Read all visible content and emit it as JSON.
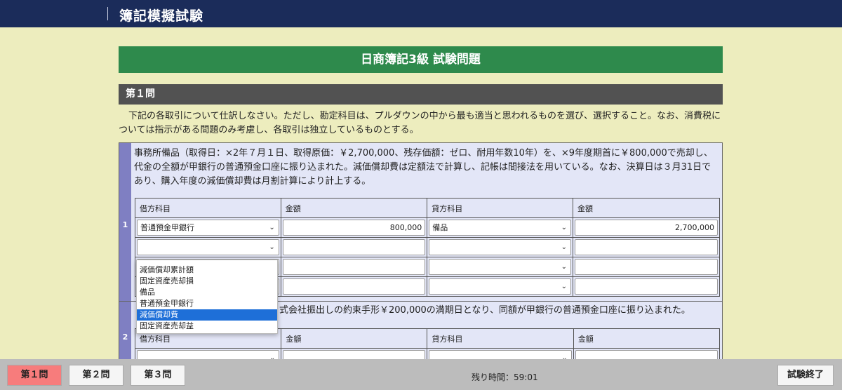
{
  "app": {
    "title": "簿記模擬試験"
  },
  "exam": {
    "title": "日商簿記3級 試験問題"
  },
  "section": {
    "title": "第１問"
  },
  "instructions": "下記の各取引について仕訳しなさい。ただし、勘定科目は、プルダウンの中から最も適当と思われるものを選び、選択すること。なお、消費税については指示がある問題のみ考慮し、各取引は独立しているものとする。",
  "questions": [
    {
      "number": "1",
      "text": "事務所備品（取得日：×2年７月１日、取得原価：￥2,700,000、残存価額：ゼロ、耐用年数10年）を、×9年度期首に￥800,000で売却し、代金の全額が甲銀行の普通預金口座に振り込まれた。減価償却費は定額法で計算し、記帳は間接法を用いている。なお、決算日は３月31日であり、購入年度の減価償却費は月割計算により計上する。",
      "headers": [
        "借方科目",
        "金額",
        "貸方科目",
        "金額"
      ],
      "rows": [
        {
          "debit_account": "普通預金甲銀行",
          "debit_amount": "800,000",
          "credit_account": "備品",
          "credit_amount": "2,700,000"
        },
        {
          "debit_account": "",
          "debit_amount": "",
          "credit_account": "",
          "credit_amount": ""
        },
        {
          "debit_account": "",
          "debit_amount": "",
          "credit_account": "",
          "credit_amount": ""
        },
        {
          "debit_account": "",
          "debit_amount": "",
          "credit_account": "",
          "credit_amount": ""
        }
      ]
    },
    {
      "number": "2",
      "text_visible": "式会社振出しの約束手形￥200,000の満期日となり、同額が甲銀行の普通預金口座に振り込まれた。",
      "headers": [
        "借方科目",
        "金額",
        "貸方科目",
        "金額"
      ]
    }
  ],
  "dropdown": {
    "options": [
      "減価償却累計額",
      "固定資産売却損",
      "備品",
      "普通預金甲銀行",
      "減価償却費",
      "固定資産売却益"
    ],
    "highlighted": "減価償却費"
  },
  "footer": {
    "tabs": [
      "第１問",
      "第２問",
      "第３問"
    ],
    "active_tab": "第１問",
    "timer": "残り時間：59:01",
    "end_button": "試験終了"
  },
  "colors": {
    "header_bg": "#1b2c5a",
    "page_bg": "#ededbe",
    "exam_title_bg": "#2e8a4c",
    "section_bg": "#525252",
    "active_tab_bg": "#f77c7c",
    "dropdown_highlight": "#1e6fd8"
  }
}
